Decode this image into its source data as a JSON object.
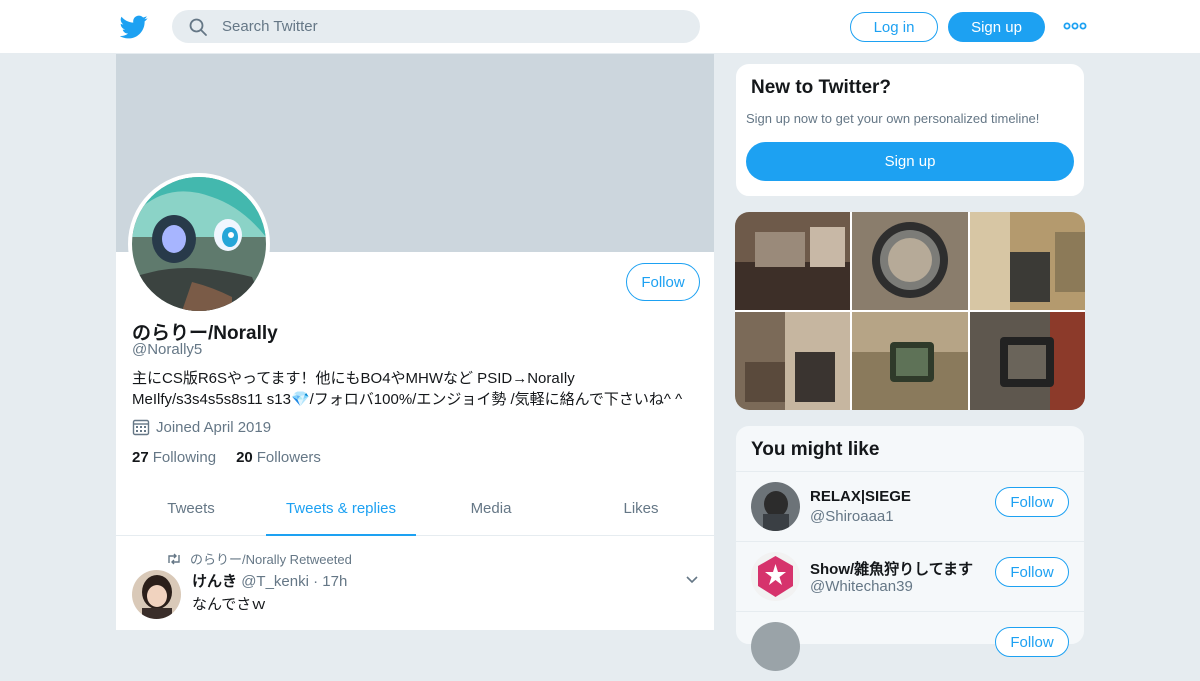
{
  "header": {
    "logo": "twitter-bird-icon",
    "search_placeholder": "Search Twitter",
    "login_label": "Log in",
    "signup_label": "Sign up",
    "more_icon": "more-dots-icon",
    "brand_color": "#1da1f2"
  },
  "profile": {
    "name": "のらりー/Norally",
    "handle": "@Norally5",
    "bio_line1": "主にCS版R6Sやってます！他にもBO4やMHWなど PSID→NoraIly",
    "bio_line2": "MeIlfy/s3s4s5s8s11 s13💎/フォロバ100%/エンジョイ勢 /気軽に絡んで下さいね^ ^",
    "joined": "Joined April 2019",
    "following_count": "27",
    "following_label": "Following",
    "followers_count": "20",
    "followers_label": "Followers",
    "follow_label": "Follow"
  },
  "tabs": [
    {
      "label": "Tweets"
    },
    {
      "label": "Tweets & replies"
    },
    {
      "label": "Media"
    },
    {
      "label": "Likes"
    }
  ],
  "tweet": {
    "retweet_line": "のらりー/Norally Retweeted",
    "author_name": "けんき",
    "author_handle": "@T_kenki",
    "separator": "·",
    "time": "17h",
    "text": "なんでさｗ"
  },
  "sidebar": {
    "new_title": "New to Twitter?",
    "new_text": "Sign up now to get your own personalized timeline!",
    "new_signup": "Sign up",
    "might_like_title": "You might like",
    "suggestions": [
      {
        "name": "RELAX|SIEGE",
        "handle": "@Shiroaaa1",
        "follow": "Follow"
      },
      {
        "name": "S⁠h⁠o⁠w⁠/雑魚狩りしてます",
        "handle": "@Whitechan39",
        "follow": "Follow"
      },
      {
        "name": "",
        "handle": "",
        "follow": "Follow"
      }
    ]
  }
}
